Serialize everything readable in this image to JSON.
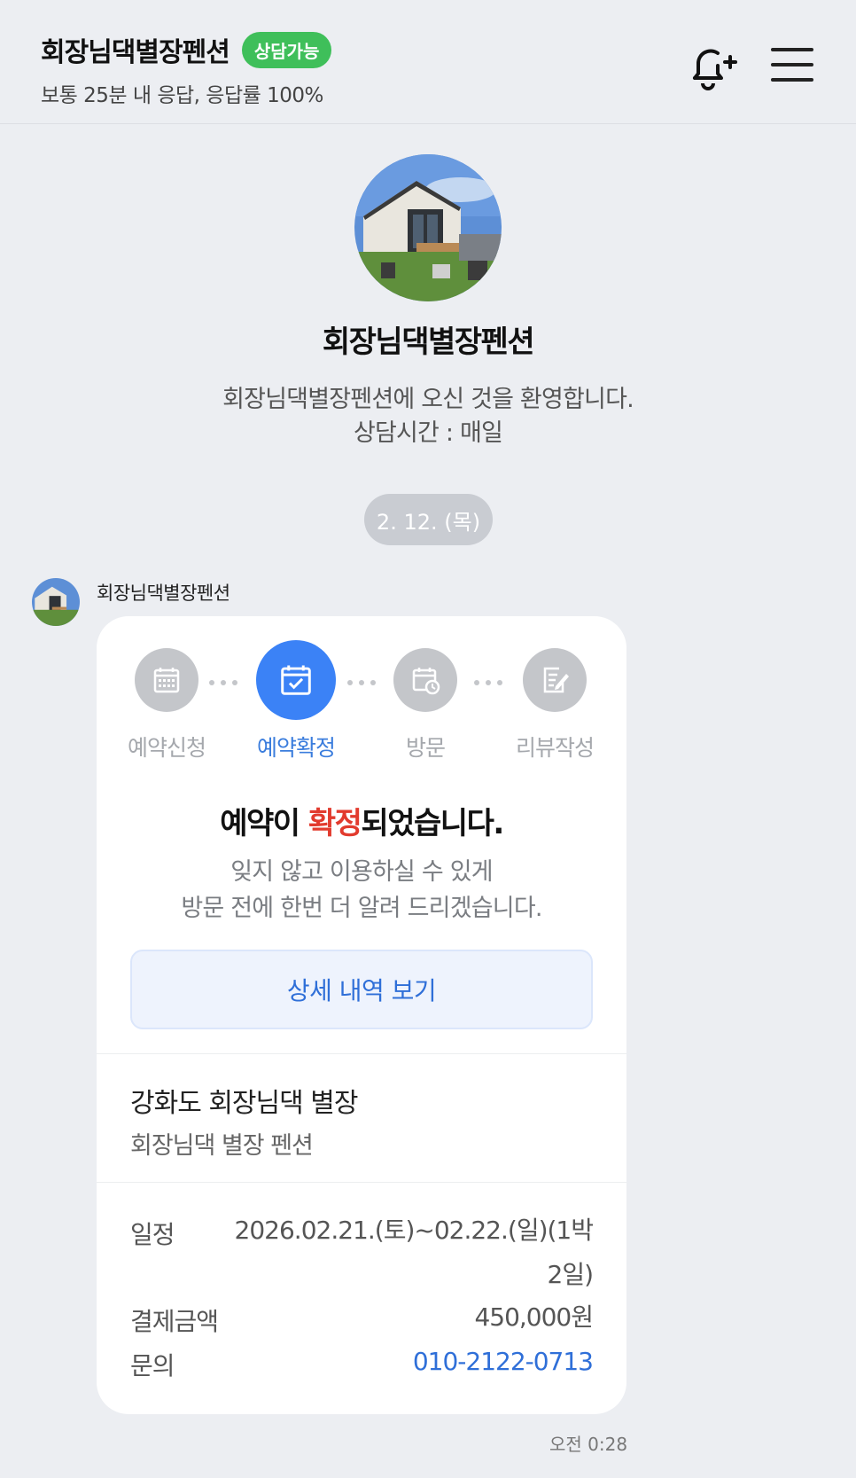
{
  "header": {
    "title": "회장님댁별장펜션",
    "badge": "상담가능",
    "subtitle": "보통 25분 내 응답, 응답률 100%",
    "icons": [
      "bell-plus-icon",
      "hamburger-menu-icon"
    ]
  },
  "profile": {
    "name": "회장님댁별장펜션",
    "welcome": "회장님댁별장펜션에 오신 것을 환영합니다.",
    "hours": "상담시간 : 매일"
  },
  "date_divider": "2. 12. (목)",
  "message": {
    "sender": "회장님댁별장펜션",
    "time": "오전 0:28",
    "steps": [
      {
        "label": "예약신청",
        "icon": "calendar-grid-icon"
      },
      {
        "label": "예약확정",
        "icon": "calendar-check-icon"
      },
      {
        "label": "방문",
        "icon": "calendar-clock-icon"
      },
      {
        "label": "리뷰작성",
        "icon": "document-edit-icon"
      }
    ],
    "confirm_prefix": "예약이 ",
    "confirm_highlight": "확정",
    "confirm_suffix": "되었습니다.",
    "desc_line1": "잊지 않고 이용하실 수 있게",
    "desc_line2": "방문 전에 한번 더 알려 드리겠습니다.",
    "detail_button": "상세 내역 보기",
    "property_name": "강화도 회장님댁 별장",
    "property_sub": "회장님댁 별장 펜션",
    "info": {
      "schedule_label": "일정",
      "schedule_line1": "2026.02.21.(토)~02.22.(일)(1박",
      "schedule_line2": "2일)",
      "price_label": "결제금액",
      "price_value": "450,000원",
      "contact_label": "문의",
      "contact_value": "010-2122-0713"
    }
  },
  "colors": {
    "accent": "#3b82f6",
    "badge_green": "#3fbf5a",
    "highlight_red": "#e23b2e",
    "link_blue": "#2f6fd8"
  }
}
